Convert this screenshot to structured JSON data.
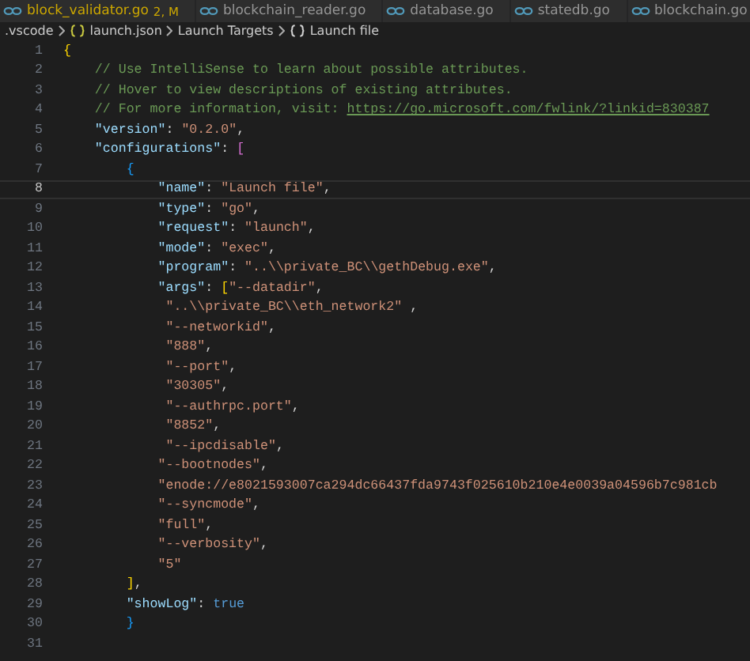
{
  "tabs": [
    {
      "label": "block_validator.go",
      "badge": "2, M",
      "modified": true
    },
    {
      "label": "blockchain_reader.go",
      "modified": false
    },
    {
      "label": "database.go",
      "modified": false
    },
    {
      "label": "statedb.go",
      "modified": false
    },
    {
      "label": "blockchain.go",
      "modified": false
    }
  ],
  "breadcrumb": [
    {
      "label": ".vscode",
      "kind": "folder"
    },
    {
      "label": "launch.json",
      "kind": "json"
    },
    {
      "label": "Launch Targets",
      "kind": "plain"
    },
    {
      "label": "Launch file",
      "kind": "object"
    }
  ],
  "lines": [
    {
      "number": "1",
      "current": false,
      "tokens": [
        {
          "kind": "bracket1",
          "text": "{"
        }
      ]
    },
    {
      "number": "2",
      "current": false,
      "tokens": [
        {
          "kind": "comment",
          "text": "    // Use IntelliSense to learn about possible attributes."
        }
      ]
    },
    {
      "number": "3",
      "current": false,
      "tokens": [
        {
          "kind": "comment",
          "text": "    // Hover to view descriptions of existing attributes."
        }
      ]
    },
    {
      "number": "4",
      "current": false,
      "tokens": [
        {
          "kind": "comment",
          "text": "    // For more information, visit: "
        },
        {
          "kind": "link",
          "text": "https://go.microsoft.com/fwlink/?linkid=830387"
        }
      ]
    },
    {
      "number": "5",
      "current": false,
      "tokens": [
        {
          "kind": "key",
          "text": "    \"version\""
        },
        {
          "kind": "punct",
          "text": ": "
        },
        {
          "kind": "string",
          "text": "\"0.2.0\""
        },
        {
          "kind": "punct",
          "text": ","
        }
      ]
    },
    {
      "number": "6",
      "current": false,
      "tokens": [
        {
          "kind": "key",
          "text": "    \"configurations\""
        },
        {
          "kind": "punct",
          "text": ": "
        },
        {
          "kind": "bracket2",
          "text": "["
        }
      ]
    },
    {
      "number": "7",
      "current": false,
      "tokens": [
        {
          "kind": "bracket3",
          "text": "        {"
        }
      ]
    },
    {
      "number": "8",
      "current": true,
      "tokens": [
        {
          "kind": "key",
          "text": "            \"name\""
        },
        {
          "kind": "punct",
          "text": ": "
        },
        {
          "kind": "string",
          "text": "\"Launch file\""
        },
        {
          "kind": "punct",
          "text": ","
        }
      ]
    },
    {
      "number": "9",
      "current": false,
      "tokens": [
        {
          "kind": "key",
          "text": "            \"type\""
        },
        {
          "kind": "punct",
          "text": ": "
        },
        {
          "kind": "string",
          "text": "\"go\""
        },
        {
          "kind": "punct",
          "text": ","
        }
      ]
    },
    {
      "number": "10",
      "current": false,
      "tokens": [
        {
          "kind": "key",
          "text": "            \"request\""
        },
        {
          "kind": "punct",
          "text": ": "
        },
        {
          "kind": "string",
          "text": "\"launch\""
        },
        {
          "kind": "punct",
          "text": ","
        }
      ]
    },
    {
      "number": "11",
      "current": false,
      "tokens": [
        {
          "kind": "key",
          "text": "            \"mode\""
        },
        {
          "kind": "punct",
          "text": ": "
        },
        {
          "kind": "string",
          "text": "\"exec\""
        },
        {
          "kind": "punct",
          "text": ","
        }
      ]
    },
    {
      "number": "12",
      "current": false,
      "tokens": [
        {
          "kind": "key",
          "text": "            \"program\""
        },
        {
          "kind": "punct",
          "text": ": "
        },
        {
          "kind": "string",
          "text": "\"..\\\\private_BC\\\\gethDebug.exe\""
        },
        {
          "kind": "punct",
          "text": ","
        }
      ]
    },
    {
      "number": "13",
      "current": false,
      "tokens": [
        {
          "kind": "key",
          "text": "            \"args\""
        },
        {
          "kind": "punct",
          "text": ": "
        },
        {
          "kind": "bracket1",
          "text": "["
        },
        {
          "kind": "string",
          "text": "\"--datadir\""
        },
        {
          "kind": "punct",
          "text": ","
        }
      ]
    },
    {
      "number": "14",
      "current": false,
      "tokens": [
        {
          "kind": "string",
          "text": "             \"..\\\\private_BC\\\\eth_network2\""
        },
        {
          "kind": "punct",
          "text": " ,"
        }
      ]
    },
    {
      "number": "15",
      "current": false,
      "tokens": [
        {
          "kind": "string",
          "text": "             \"--networkid\""
        },
        {
          "kind": "punct",
          "text": ","
        }
      ]
    },
    {
      "number": "16",
      "current": false,
      "tokens": [
        {
          "kind": "string",
          "text": "             \"888\""
        },
        {
          "kind": "punct",
          "text": ","
        }
      ]
    },
    {
      "number": "17",
      "current": false,
      "tokens": [
        {
          "kind": "string",
          "text": "             \"--port\""
        },
        {
          "kind": "punct",
          "text": ","
        }
      ]
    },
    {
      "number": "18",
      "current": false,
      "tokens": [
        {
          "kind": "string",
          "text": "             \"30305\""
        },
        {
          "kind": "punct",
          "text": ","
        }
      ]
    },
    {
      "number": "19",
      "current": false,
      "tokens": [
        {
          "kind": "string",
          "text": "             \"--authrpc.port\""
        },
        {
          "kind": "punct",
          "text": ","
        }
      ]
    },
    {
      "number": "20",
      "current": false,
      "tokens": [
        {
          "kind": "string",
          "text": "             \"8852\""
        },
        {
          "kind": "punct",
          "text": ","
        }
      ]
    },
    {
      "number": "21",
      "current": false,
      "tokens": [
        {
          "kind": "string",
          "text": "             \"--ipcdisable\""
        },
        {
          "kind": "punct",
          "text": ","
        }
      ]
    },
    {
      "number": "22",
      "current": false,
      "tokens": [
        {
          "kind": "string",
          "text": "            \"--bootnodes\""
        },
        {
          "kind": "punct",
          "text": ","
        }
      ]
    },
    {
      "number": "23",
      "current": false,
      "tokens": [
        {
          "kind": "string",
          "text": "            \"enode://e8021593007ca294dc66437fda9743f025610b210e4e0039a04596b7c981cb"
        }
      ]
    },
    {
      "number": "24",
      "current": false,
      "tokens": [
        {
          "kind": "string",
          "text": "            \"--syncmode\""
        },
        {
          "kind": "punct",
          "text": ","
        }
      ]
    },
    {
      "number": "25",
      "current": false,
      "tokens": [
        {
          "kind": "string",
          "text": "            \"full\""
        },
        {
          "kind": "punct",
          "text": ","
        }
      ]
    },
    {
      "number": "26",
      "current": false,
      "tokens": [
        {
          "kind": "string",
          "text": "            \"--verbosity\""
        },
        {
          "kind": "punct",
          "text": ","
        }
      ]
    },
    {
      "number": "27",
      "current": false,
      "tokens": [
        {
          "kind": "string",
          "text": "            \"5\""
        }
      ]
    },
    {
      "number": "28",
      "current": false,
      "tokens": [
        {
          "kind": "bracket1",
          "text": "        ]"
        },
        {
          "kind": "punct",
          "text": ","
        }
      ]
    },
    {
      "number": "29",
      "current": false,
      "tokens": [
        {
          "kind": "key",
          "text": "        \"showLog\""
        },
        {
          "kind": "punct",
          "text": ": "
        },
        {
          "kind": "bool",
          "text": "true"
        }
      ]
    },
    {
      "number": "30",
      "current": false,
      "tokens": [
        {
          "kind": "bracket3",
          "text": "        }"
        }
      ]
    },
    {
      "number": "31",
      "current": false
    }
  ]
}
